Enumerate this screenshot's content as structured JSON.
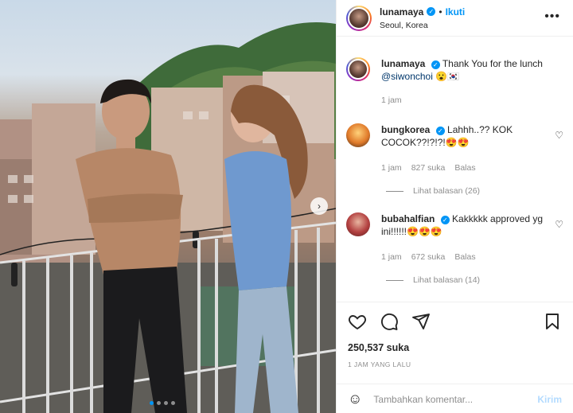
{
  "post": {
    "author": "lunamaya",
    "follow_label": "Ikuti",
    "separator": "•",
    "location": "Seoul, Korea",
    "more_label": "•••"
  },
  "caption": {
    "username": "lunamaya",
    "text": "Thank You for the lunch",
    "mention": "@siwonchoi",
    "emoji": "😮🇰🇷",
    "time": "1 jam"
  },
  "comments": [
    {
      "username": "bungkorea",
      "text": "Lahhh..?? KOK COCOK??!?!?!😍😍",
      "time": "1 jam",
      "likes": "827 suka",
      "reply_label": "Balas",
      "view_replies": "Lihat balasan (26)"
    },
    {
      "username": "bubahalfian",
      "text": "Kakkkkk approved yg ini!!!!!!😍😍😍",
      "time": "1 jam",
      "likes": "672 suka",
      "reply_label": "Balas",
      "view_replies": "Lihat balasan (14)"
    }
  ],
  "actions": {
    "like_icon": "heart-icon",
    "comment_icon": "comment-icon",
    "share_icon": "share-icon",
    "save_icon": "bookmark-icon"
  },
  "likes_count": "250,537 suka",
  "time_ago": "1 JAM YANG LALU",
  "add_comment": {
    "placeholder": "Tambahkan komentar...",
    "post_label": "Kirim"
  },
  "colors": {
    "accent": "#0095f6",
    "text": "#262626",
    "muted": "#8e8e8e"
  }
}
